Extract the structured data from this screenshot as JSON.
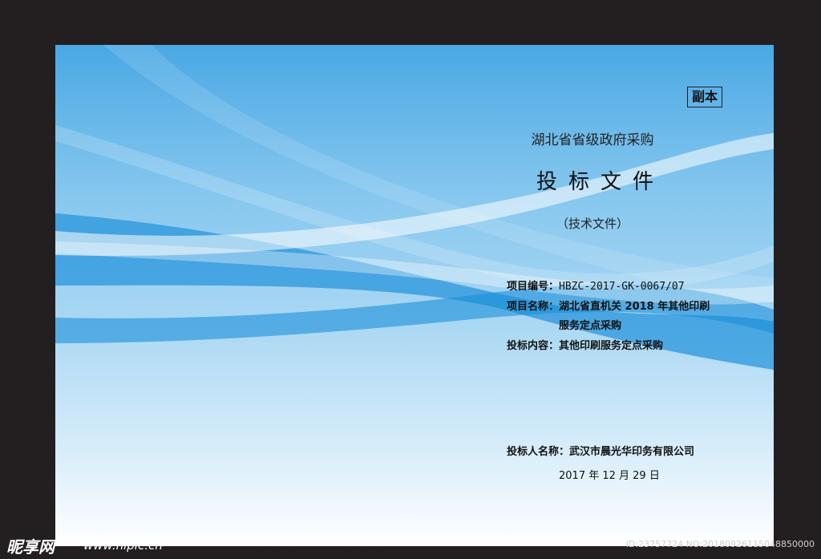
{
  "document": {
    "copy_badge": "副本",
    "heading": "湖北省省级政府采购",
    "title": "投标文件",
    "subtitle": "（技术文件）",
    "fields": {
      "project_no_label": "项目编号：",
      "project_no_value": "HBZC-2017-GK-0067/07",
      "project_name_label": "项目名称：",
      "project_name_value_line1": "湖北省直机关 2018 年其他印刷",
      "project_name_value_line2": "服务定点采购",
      "bid_content_label": "投标内容：",
      "bid_content_value": "其他印刷服务定点采购",
      "bidder_label": "投标人名称：",
      "bidder_value": "武汉市晨光华印务有限公司"
    },
    "date": "2017 年  12 月  29 日"
  },
  "watermark": {
    "logo": "昵享网",
    "url": "www.nipic.cn",
    "id_text": "ID:23757724 NO:20180926115048850000"
  },
  "colors": {
    "frame": "#231f20",
    "page_top": "#4aa8e4",
    "page_bottom": "#ffffff",
    "wave_dark": "#1b8fd9"
  }
}
